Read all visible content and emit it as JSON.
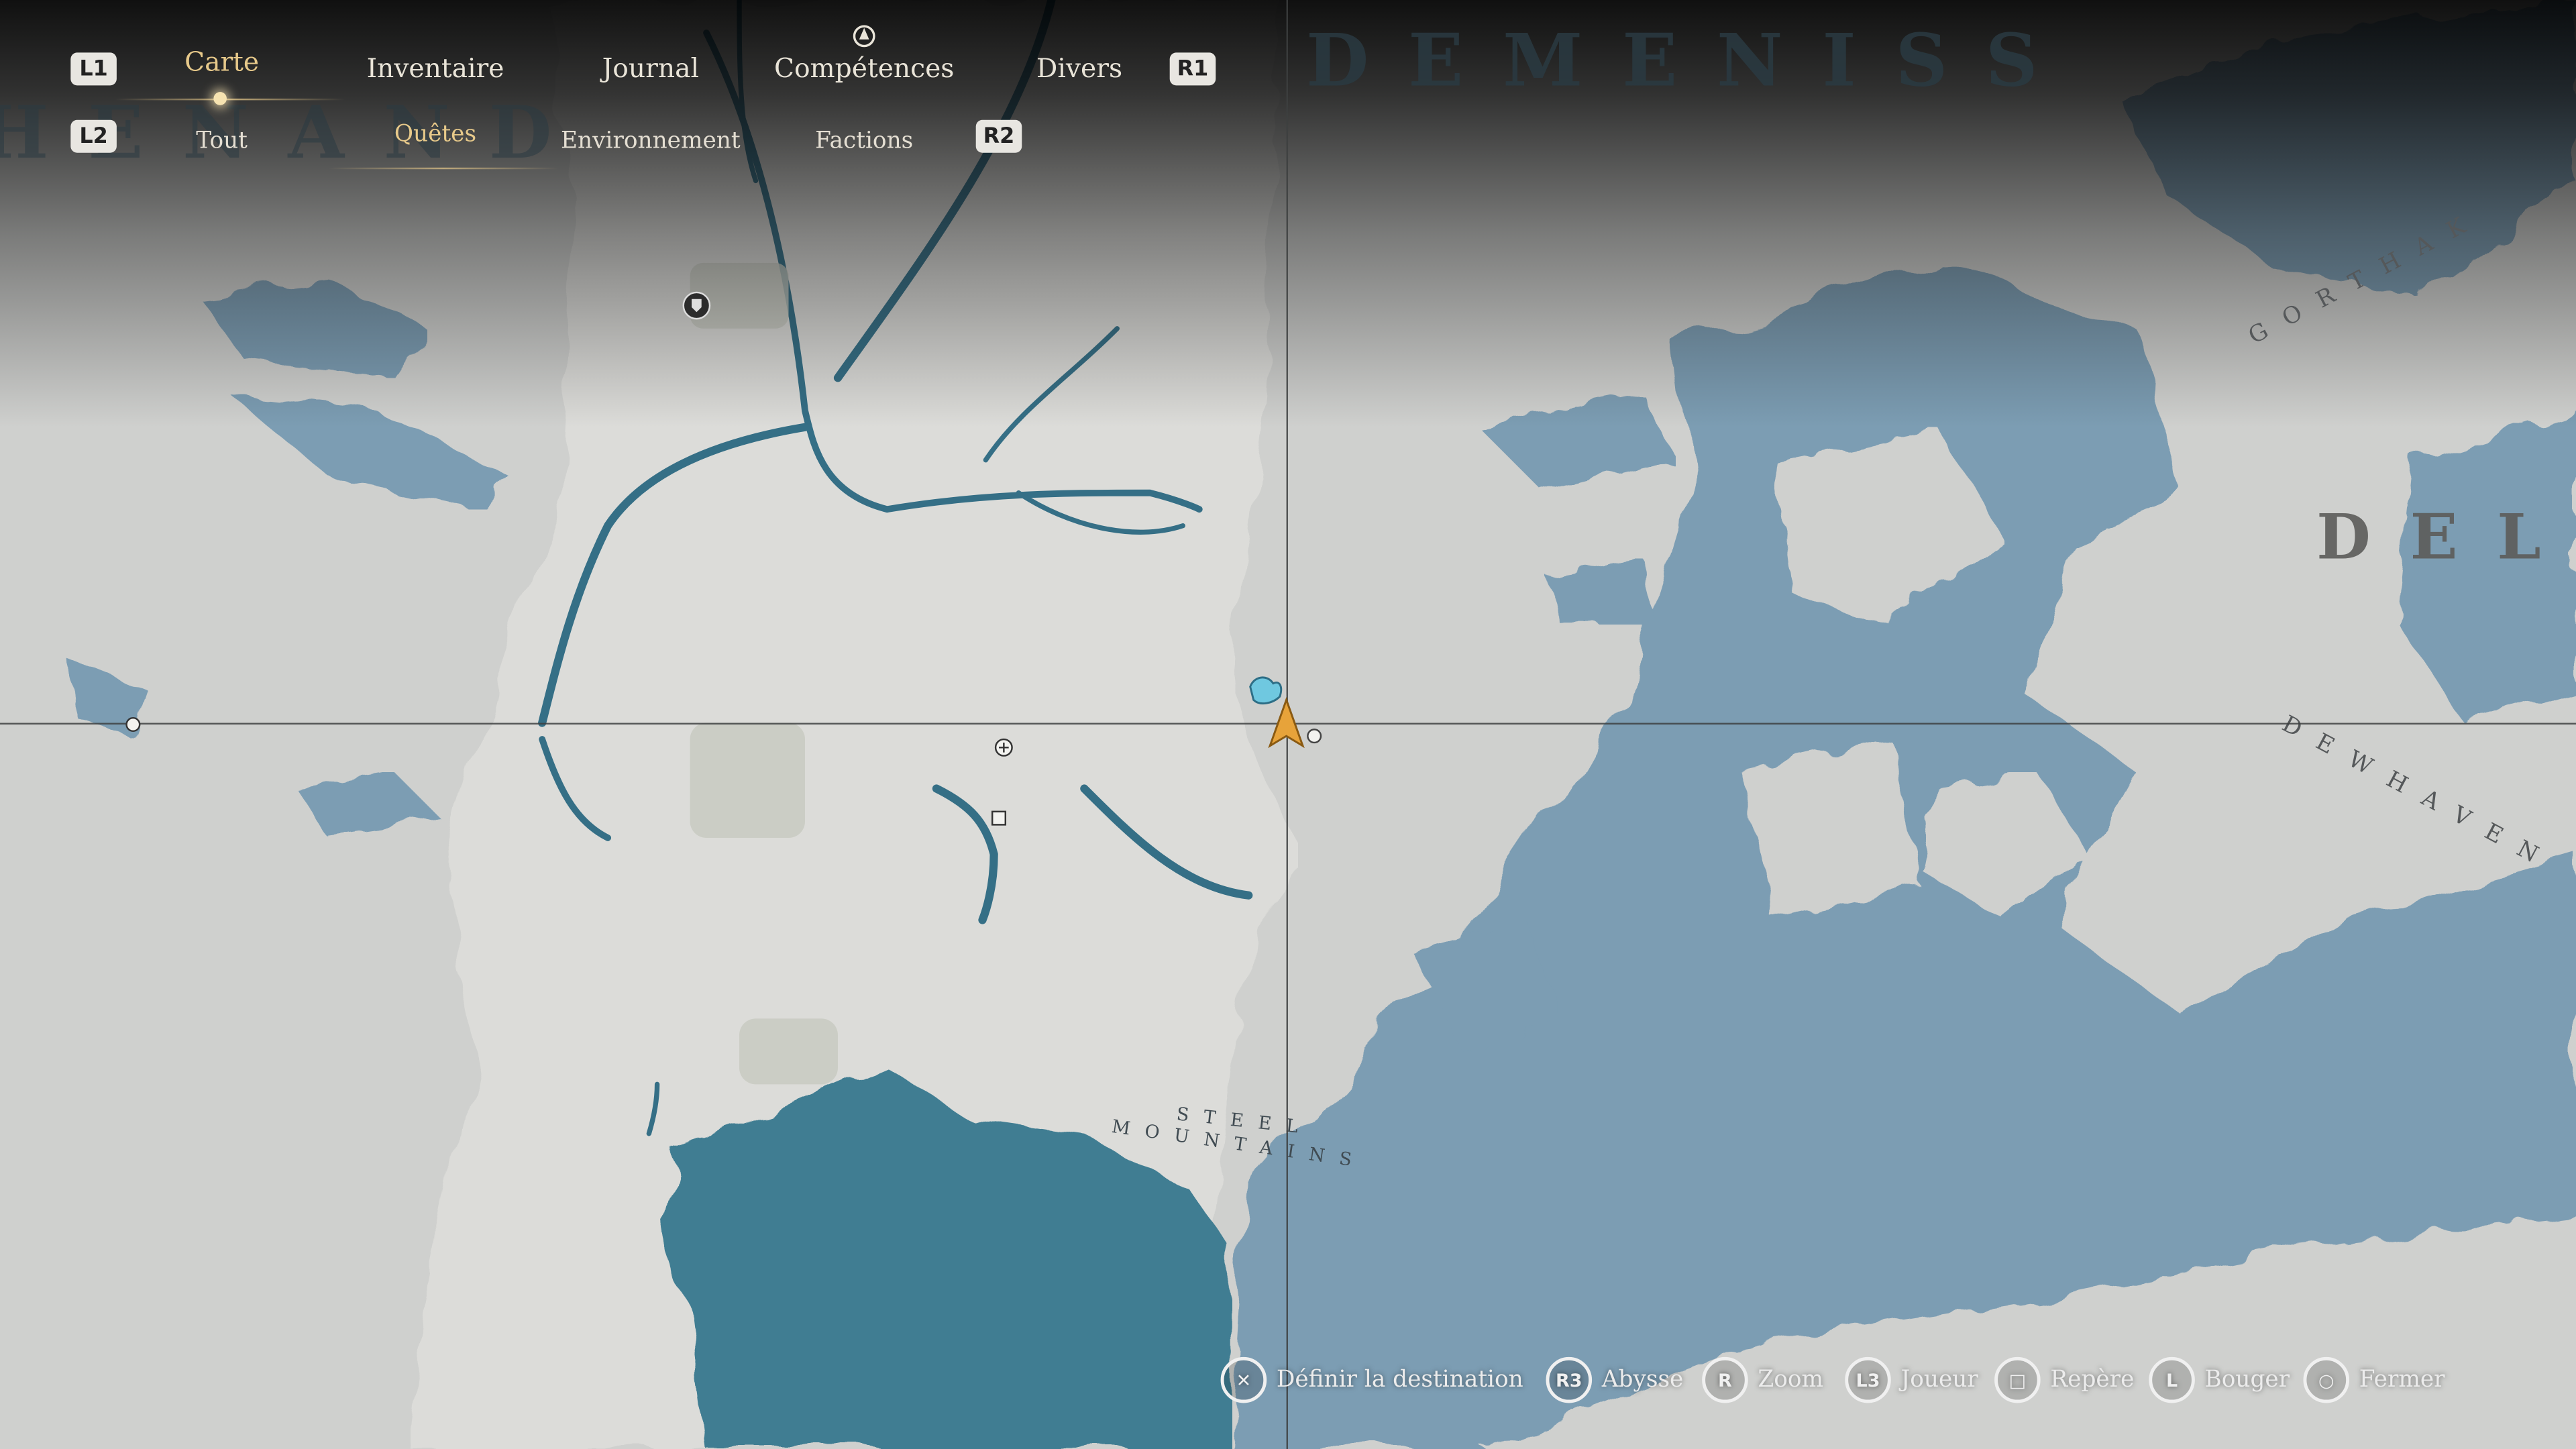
{
  "top_nav": {
    "left_trigger": "L1",
    "right_trigger": "R1",
    "tabs": [
      {
        "label": "Carte",
        "active": true
      },
      {
        "label": "Inventaire",
        "active": false
      },
      {
        "label": "Journal",
        "active": false
      },
      {
        "label": "Compétences",
        "active": false
      },
      {
        "label": "Divers",
        "active": false
      }
    ]
  },
  "filter_nav": {
    "left_trigger": "L2",
    "right_trigger": "R2",
    "filters": [
      {
        "label": "Tout",
        "active": false
      },
      {
        "label": "Quêtes",
        "active": true
      },
      {
        "label": "Environnement",
        "active": false
      },
      {
        "label": "Factions",
        "active": false
      }
    ]
  },
  "map": {
    "regions": {
      "top_center": "DEMENISS",
      "top_left": "HENAND",
      "right": "DEL",
      "right_small_1": "GORTHAK",
      "right_small_2": "DEWHAVEN"
    },
    "labels": {
      "steel": "STEEL",
      "mountains": "MOUNTAINS"
    },
    "colors": {
      "land": "#d2d3d1",
      "dark_land": "#c6c8c5",
      "shallow_water": "#7b9db3",
      "deep_water": "#3f7d92",
      "river": "#356f86",
      "accent": "#e7c98a",
      "player": "#e7a33a",
      "quest_marker": "#6fc8e0"
    }
  },
  "hints": [
    {
      "button": "✕",
      "label": "Définir la destination",
      "icon": "cross-icon"
    },
    {
      "button": "R3",
      "label": "Abysse",
      "icon": "r3-icon"
    },
    {
      "button": "R",
      "label": "Zoom",
      "icon": "r-stick-icon"
    },
    {
      "button": "L3",
      "label": "Joueur",
      "icon": "l3-icon"
    },
    {
      "button": "□",
      "label": "Repère",
      "icon": "square-icon"
    },
    {
      "button": "L",
      "label": "Bouger",
      "icon": "l-stick-icon"
    },
    {
      "button": "○",
      "label": "Fermer",
      "icon": "circle-icon"
    }
  ]
}
